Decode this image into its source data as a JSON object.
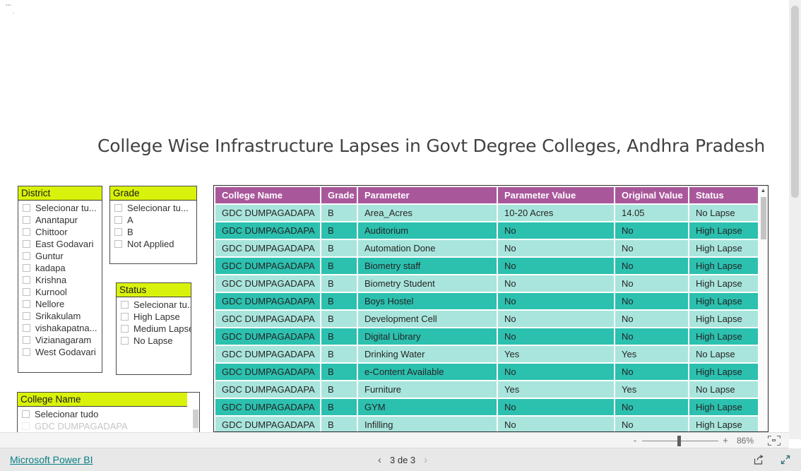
{
  "report": {
    "title": "College Wise Infrastructure Lapses in Govt Degree Colleges, Andhra Pradesh",
    "ghost_text": "▪▪▪"
  },
  "colors": {
    "slicer_title_highlight": "#d9f20b",
    "table_header": "#a9579b",
    "row_light": "#a9e5dc",
    "row_dark": "#2cc0af",
    "brand_link": "#077e84"
  },
  "slicers": [
    {
      "id": "district",
      "title": "District",
      "items": [
        "Selecionar tu...",
        "Anantapur",
        "Chittoor",
        "East Godavari",
        "Guntur",
        "kadapa",
        "Krishna",
        "Kurnool",
        "Nellore",
        "Srikakulam",
        "vishakapatna...",
        "Vizianagaram",
        "West Godavari"
      ]
    },
    {
      "id": "grade",
      "title": "Grade",
      "items": [
        "Selecionar tu...",
        "A",
        "B",
        "Not Applied"
      ]
    },
    {
      "id": "status",
      "title": "Status",
      "items": [
        "Selecionar tu...",
        "High Lapse",
        "Medium Lapse",
        "No Lapse"
      ]
    },
    {
      "id": "college",
      "title": "College Name",
      "items": [
        "Selecionar tudo",
        "GDC DUMPAGADAPA"
      ]
    }
  ],
  "table": {
    "columns": [
      "College Name",
      "Grade",
      "Parameter",
      "Parameter Value",
      "Original Value",
      "Status"
    ],
    "rows": [
      [
        "GDC DUMPAGADAPA",
        "B",
        "Area_Acres",
        "10-20 Acres",
        "14.05",
        "No Lapse"
      ],
      [
        "GDC DUMPAGADAPA",
        "B",
        "Auditorium",
        "No",
        "No",
        "High Lapse"
      ],
      [
        "GDC DUMPAGADAPA",
        "B",
        "Automation Done",
        "No",
        "No",
        "High Lapse"
      ],
      [
        "GDC DUMPAGADAPA",
        "B",
        "Biometry staff",
        "No",
        "No",
        "High Lapse"
      ],
      [
        "GDC DUMPAGADAPA",
        "B",
        "Biometry Student",
        "No",
        "No",
        "High Lapse"
      ],
      [
        "GDC DUMPAGADAPA",
        "B",
        "Boys Hostel",
        "No",
        "No",
        "High Lapse"
      ],
      [
        "GDC DUMPAGADAPA",
        "B",
        "Development Cell",
        "No",
        "No",
        "High Lapse"
      ],
      [
        "GDC DUMPAGADAPA",
        "B",
        "Digital Library",
        "No",
        "No",
        "High Lapse"
      ],
      [
        "GDC DUMPAGADAPA",
        "B",
        "Drinking Water",
        "Yes",
        "Yes",
        "No Lapse"
      ],
      [
        "GDC DUMPAGADAPA",
        "B",
        "e-Content Available",
        "No",
        "No",
        "High Lapse"
      ],
      [
        "GDC DUMPAGADAPA",
        "B",
        "Furniture",
        "Yes",
        "Yes",
        "No Lapse"
      ],
      [
        "GDC DUMPAGADAPA",
        "B",
        "GYM",
        "No",
        "No",
        "High Lapse"
      ],
      [
        "GDC DUMPAGADAPA",
        "B",
        "Infilling",
        "No",
        "No",
        "High Lapse"
      ]
    ]
  },
  "zoombar": {
    "minus_label": "-",
    "plus_label": "+",
    "percent": "86%",
    "fit_icon": "fit-to-page-icon"
  },
  "footer": {
    "brand": "Microsoft Power BI",
    "prev_icon": "chevron-left-icon",
    "next_icon": "chevron-right-icon",
    "page_label": "3 de 3",
    "share_icon": "share-icon",
    "fullscreen_icon": "fullscreen-icon"
  }
}
